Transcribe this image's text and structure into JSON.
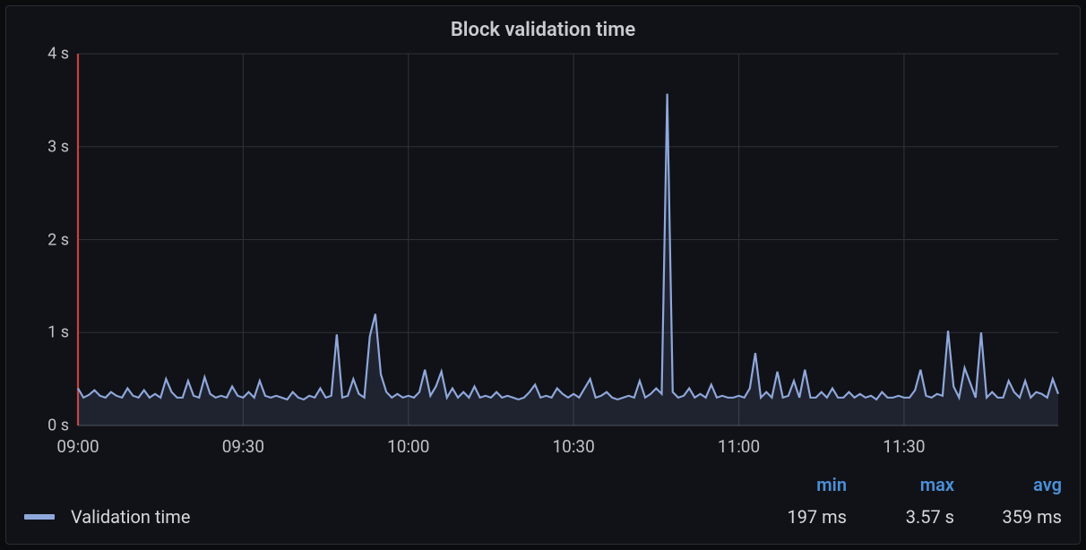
{
  "title": "Block validation time",
  "y_ticks": [
    "0 s",
    "1 s",
    "2 s",
    "3 s",
    "4 s"
  ],
  "x_ticks": [
    "09:00",
    "09:30",
    "10:00",
    "10:30",
    "11:00",
    "11:30"
  ],
  "legend": {
    "series_label": "Validation time",
    "columns": [
      "min",
      "max",
      "avg"
    ],
    "values": [
      "197 ms",
      "3.57 s",
      "359 ms"
    ]
  },
  "chart_data": {
    "type": "line",
    "title": "Block validation time",
    "xlabel": "",
    "ylabel": "",
    "ylim": [
      0,
      4
    ],
    "x_unit": "minutes since 09:00",
    "y_unit": "seconds",
    "series": [
      {
        "name": "Validation time",
        "color": "#8fa8dc",
        "x": [
          0,
          1,
          2,
          3,
          4,
          5,
          6,
          7,
          8,
          9,
          10,
          11,
          12,
          13,
          14,
          15,
          16,
          17,
          18,
          19,
          20,
          21,
          22,
          23,
          24,
          25,
          26,
          27,
          28,
          29,
          30,
          31,
          32,
          33,
          34,
          35,
          36,
          37,
          38,
          39,
          40,
          41,
          42,
          43,
          44,
          45,
          46,
          47,
          48,
          49,
          50,
          51,
          52,
          53,
          54,
          55,
          56,
          57,
          58,
          59,
          60,
          61,
          62,
          63,
          64,
          65,
          66,
          67,
          68,
          69,
          70,
          71,
          72,
          73,
          74,
          75,
          76,
          77,
          78,
          79,
          80,
          81,
          82,
          83,
          84,
          85,
          86,
          87,
          88,
          89,
          90,
          91,
          92,
          93,
          94,
          95,
          96,
          97,
          98,
          99,
          100,
          101,
          102,
          103,
          104,
          105,
          106,
          107,
          108,
          109,
          110,
          111,
          112,
          113,
          114,
          115,
          116,
          117,
          118,
          119,
          120,
          121,
          122,
          123,
          124,
          125,
          126,
          127,
          128,
          129,
          130,
          131,
          132,
          133,
          134,
          135,
          136,
          137,
          138,
          139,
          140,
          141,
          142,
          143,
          144,
          145,
          146,
          147,
          148,
          149,
          150,
          151,
          152,
          153,
          154,
          155,
          156,
          157,
          158,
          159,
          160,
          161,
          162,
          163,
          164,
          165,
          166,
          167,
          168,
          169,
          170,
          171,
          172,
          173,
          174,
          175,
          176,
          177,
          178
        ],
        "values": [
          0.4,
          0.3,
          0.33,
          0.38,
          0.32,
          0.3,
          0.36,
          0.32,
          0.3,
          0.4,
          0.32,
          0.3,
          0.38,
          0.3,
          0.34,
          0.3,
          0.5,
          0.36,
          0.3,
          0.3,
          0.48,
          0.32,
          0.3,
          0.52,
          0.34,
          0.3,
          0.32,
          0.3,
          0.42,
          0.32,
          0.3,
          0.36,
          0.3,
          0.48,
          0.32,
          0.3,
          0.32,
          0.3,
          0.28,
          0.36,
          0.3,
          0.28,
          0.32,
          0.3,
          0.4,
          0.3,
          0.32,
          0.98,
          0.3,
          0.32,
          0.5,
          0.34,
          0.3,
          0.96,
          1.2,
          0.55,
          0.36,
          0.3,
          0.34,
          0.3,
          0.32,
          0.3,
          0.36,
          0.6,
          0.32,
          0.42,
          0.58,
          0.3,
          0.4,
          0.3,
          0.36,
          0.3,
          0.42,
          0.3,
          0.32,
          0.3,
          0.36,
          0.3,
          0.32,
          0.3,
          0.28,
          0.3,
          0.36,
          0.44,
          0.3,
          0.32,
          0.3,
          0.4,
          0.34,
          0.3,
          0.34,
          0.3,
          0.4,
          0.5,
          0.3,
          0.32,
          0.36,
          0.3,
          0.28,
          0.3,
          0.32,
          0.3,
          0.48,
          0.3,
          0.34,
          0.4,
          0.34,
          3.57,
          0.36,
          0.3,
          0.32,
          0.4,
          0.3,
          0.34,
          0.3,
          0.44,
          0.3,
          0.32,
          0.3,
          0.3,
          0.32,
          0.3,
          0.4,
          0.78,
          0.3,
          0.36,
          0.3,
          0.58,
          0.3,
          0.32,
          0.48,
          0.3,
          0.6,
          0.3,
          0.3,
          0.36,
          0.3,
          0.4,
          0.3,
          0.3,
          0.36,
          0.3,
          0.34,
          0.3,
          0.32,
          0.28,
          0.36,
          0.3,
          0.3,
          0.32,
          0.3,
          0.3,
          0.38,
          0.6,
          0.32,
          0.3,
          0.34,
          0.32,
          1.02,
          0.42,
          0.3,
          0.62,
          0.46,
          0.3,
          1.0,
          0.3,
          0.36,
          0.3,
          0.3,
          0.48,
          0.36,
          0.3,
          0.48,
          0.3,
          0.36,
          0.34,
          0.3,
          0.5,
          0.34
        ]
      }
    ],
    "annotations": [
      {
        "type": "vline",
        "x": 0,
        "color": "#c4443c"
      }
    ],
    "x_tick_labels": [
      "09:00",
      "09:30",
      "10:00",
      "10:30",
      "11:00",
      "11:30"
    ],
    "x_tick_positions_min": [
      0,
      30,
      60,
      90,
      120,
      150
    ],
    "summary": {
      "min_ms": 197,
      "max_s": 3.57,
      "avg_ms": 359
    }
  }
}
